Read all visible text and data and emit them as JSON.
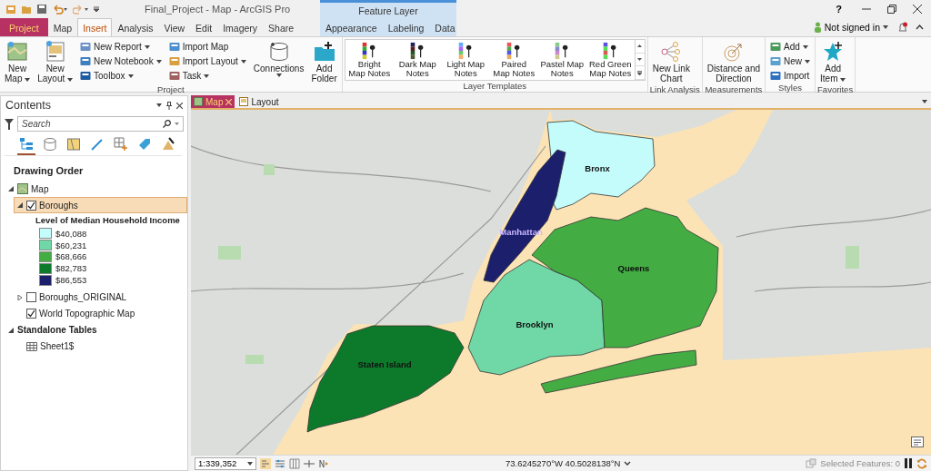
{
  "window": {
    "title": "Final_Project - Map - ArcGIS Pro",
    "help": "?"
  },
  "contextual": {
    "label": "Feature Layer"
  },
  "tabs": [
    {
      "label": "Project",
      "kind": "backstage",
      "selected": false
    },
    {
      "label": "Map",
      "kind": "core",
      "selected": false
    },
    {
      "label": "Insert",
      "kind": "core",
      "selected": true
    },
    {
      "label": "Analysis",
      "kind": "core",
      "selected": false
    },
    {
      "label": "View",
      "kind": "core",
      "selected": false
    },
    {
      "label": "Edit",
      "kind": "core",
      "selected": false
    },
    {
      "label": "Imagery",
      "kind": "core",
      "selected": false
    },
    {
      "label": "Share",
      "kind": "core",
      "selected": false
    },
    {
      "label": "Appearance",
      "kind": "contextual",
      "selected": false
    },
    {
      "label": "Labeling",
      "kind": "contextual",
      "selected": false
    },
    {
      "label": "Data",
      "kind": "contextual",
      "selected": false
    }
  ],
  "account": {
    "label": "Not signed in"
  },
  "ribbon_groups": [
    {
      "label": "Project",
      "items": [
        {
          "kind": "large",
          "lines": [
            "New",
            "Map"
          ],
          "dropdown": true
        },
        {
          "kind": "large",
          "lines": [
            "New",
            "Layout"
          ],
          "dropdown": true
        },
        {
          "kind": "stack",
          "items": [
            {
              "label": "New Report",
              "dropdown": true
            },
            {
              "label": "New Notebook",
              "dropdown": true
            },
            {
              "label": "Toolbox",
              "dropdown": true
            }
          ]
        },
        {
          "kind": "stack",
          "items": [
            {
              "label": "Import Map",
              "dropdown": false
            },
            {
              "label": "Import Layout",
              "dropdown": true
            },
            {
              "label": "Task",
              "dropdown": true
            }
          ]
        },
        {
          "kind": "large",
          "lines": [
            "Connections"
          ],
          "dropdown": true
        },
        {
          "kind": "large",
          "lines": [
            "Add",
            "Folder"
          ],
          "dropdown": false
        }
      ]
    },
    {
      "label": "Layer Templates",
      "items": [
        {
          "kind": "gallery",
          "items": [
            {
              "lines": [
                "Bright",
                "Map Notes"
              ]
            },
            {
              "lines": [
                "Dark Map",
                "Notes"
              ]
            },
            {
              "lines": [
                "Light Map",
                "Notes"
              ]
            },
            {
              "lines": [
                "Paired",
                "Map Notes"
              ]
            },
            {
              "lines": [
                "Pastel Map",
                "Notes"
              ]
            },
            {
              "lines": [
                "Red Green",
                "Map Notes"
              ]
            }
          ]
        }
      ]
    },
    {
      "label": "Link Analysis",
      "items": [
        {
          "kind": "large",
          "lines": [
            "New Link",
            "Chart"
          ],
          "dropdown": false
        }
      ]
    },
    {
      "label": "Measurements",
      "items": [
        {
          "kind": "large",
          "lines": [
            "Distance and",
            "Direction"
          ],
          "dropdown": false
        }
      ]
    },
    {
      "label": "Styles",
      "items": [
        {
          "kind": "stack",
          "items": [
            {
              "label": "Add",
              "dropdown": true
            },
            {
              "label": "New",
              "dropdown": true
            },
            {
              "label": "Import",
              "dropdown": false
            }
          ]
        }
      ]
    },
    {
      "label": "Favorites",
      "items": [
        {
          "kind": "large",
          "lines": [
            "Add",
            "Item"
          ],
          "dropdown": true
        }
      ]
    }
  ],
  "contents": {
    "title": "Contents",
    "search": {
      "placeholder": "Search"
    },
    "views": [
      {
        "selected": true
      },
      {
        "selected": false
      },
      {
        "selected": false
      },
      {
        "selected": false
      },
      {
        "selected": false
      },
      {
        "selected": false
      },
      {
        "selected": false
      }
    ],
    "heading": "Drawing Order",
    "tree": [
      {
        "label": "Map",
        "kind": "map",
        "expanded": true,
        "children": [
          {
            "label": "Boroughs",
            "kind": "layer",
            "checked": true,
            "selected": true,
            "expanded": true,
            "legend": {
              "title": "Level of Median Household Income",
              "classes": [
                {
                  "label": "$40,088",
                  "color": "#c4fcfc"
                },
                {
                  "label": "$60,231",
                  "color": "#6fd8a6"
                },
                {
                  "label": "$68,666",
                  "color": "#43ad43"
                },
                {
                  "label": "$82,783",
                  "color": "#0d7a2b"
                },
                {
                  "label": "$86,553",
                  "color": "#1c1f6c"
                }
              ]
            }
          },
          {
            "label": "Boroughs_ORIGINAL",
            "kind": "layer",
            "checked": false,
            "selected": false,
            "expanded": false
          },
          {
            "label": "World Topographic Map",
            "kind": "layer",
            "checked": true,
            "selected": false
          }
        ]
      },
      {
        "label": "Standalone Tables",
        "kind": "group",
        "expanded": true,
        "children": [
          {
            "label": "Sheet1$",
            "kind": "table"
          }
        ]
      }
    ]
  },
  "map_view": {
    "tabs": [
      {
        "label": "Map",
        "kind": "map",
        "selected": true
      },
      {
        "label": "Layout",
        "kind": "layout",
        "selected": false
      }
    ],
    "boroughs": [
      {
        "label": "Bronx",
        "color": "#c4fcfc"
      },
      {
        "label": "Brooklyn",
        "color": "#6fd8a6"
      },
      {
        "label": "Queens",
        "color": "#43ad43"
      },
      {
        "label": "Manhattan",
        "color": "#1c1f6c"
      },
      {
        "label": "Staten Island",
        "color": "#0d7a2b"
      }
    ]
  },
  "status_bar": {
    "scale": "1:339,352",
    "coordinates": "73.6245270°W 40.5028138°N",
    "selected_features": "Selected Features: 0"
  }
}
